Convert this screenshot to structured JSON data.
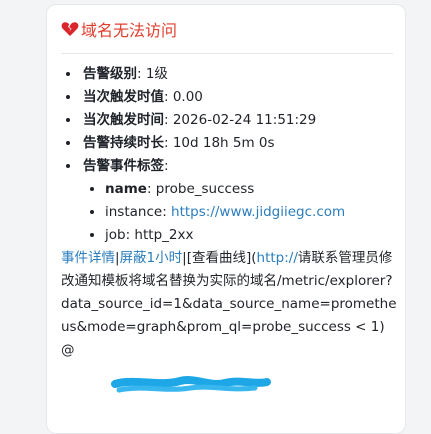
{
  "alert": {
    "title": "域名无法访问",
    "icon": "broken-heart-icon",
    "title_color": "#e03e2d"
  },
  "fields": {
    "level_key": "告警级别",
    "level_val": ": 1级",
    "value_key": "当次触发时值",
    "value_val": ": 0.00",
    "time_key": "当次触发时间",
    "time_val": ": 2026-02-24 11:51:29",
    "duration_key": "告警持续时长",
    "duration_val": ": 10d 18h 5m 0s",
    "labels_key": "告警事件标签",
    "labels_colon": ":"
  },
  "labels": {
    "name_key": "name",
    "name_val": ": probe_success",
    "instance_key": "instance: ",
    "instance_val": "https://www.jidgiiegc.com",
    "job_key": "job: ",
    "job_val": "http_2xx"
  },
  "actions": {
    "details": "事件详情",
    "sep1": "|",
    "mute": "屏蔽1小时",
    "sep2": "|",
    "curve": "[查看曲线](",
    "http": "http://",
    "rest": "请联系管理员修改通知模板将域名替换为实际的域名/metric/explorer?data_source_id=1&data_source_name=prometheus&mode=graph&prom_ql=probe_success < 1)"
  },
  "footer": {
    "at_symbol": "@"
  },
  "colors": {
    "link": "#2b7dbd",
    "redaction": "#1ea7e6"
  }
}
